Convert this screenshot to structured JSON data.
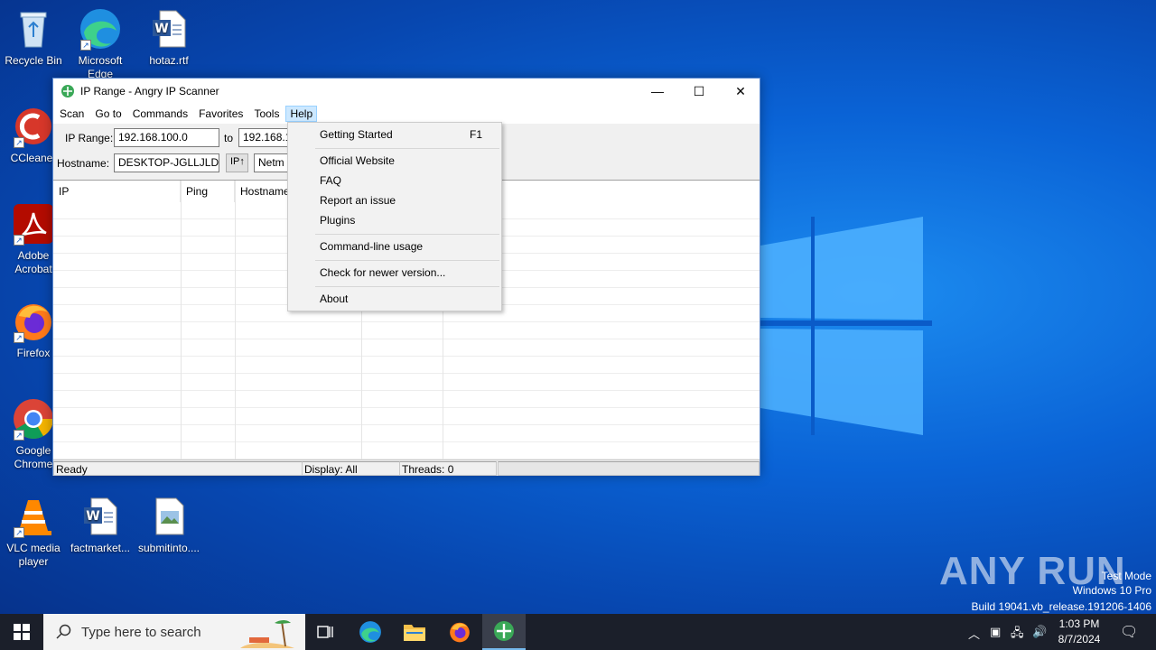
{
  "desktop": {
    "icons": [
      {
        "label": "Recycle Bin"
      },
      {
        "label": "Microsoft Edge"
      },
      {
        "label": "hotaz.rtf"
      },
      {
        "label": "CCleaner"
      },
      {
        "label": "Adobe Acrobat"
      },
      {
        "label": "Firefox"
      },
      {
        "label": "Google Chrome"
      },
      {
        "label": "VLC media player"
      },
      {
        "label": "factmarket..."
      },
      {
        "label": "submitinto...."
      }
    ]
  },
  "window": {
    "title": "IP Range - Angry IP Scanner",
    "controls": {
      "minimize": "—",
      "maximize": "☐",
      "close": "✕"
    },
    "menu": [
      "Scan",
      "Go to",
      "Commands",
      "Favorites",
      "Tools",
      "Help"
    ],
    "toolbar": {
      "ip_range_label": "IP Range:",
      "ip_from": "192.168.100.0",
      "to_label": "to",
      "ip_to": "192.168.1",
      "hostname_label": "Hostname:",
      "hostname": "DESKTOP-JGLLJLD",
      "ip_button": "IP↑",
      "netmask": "Netm"
    },
    "columns": [
      "IP",
      "Ping",
      "Hostname"
    ],
    "status": {
      "ready": "Ready",
      "display": "Display: All",
      "threads": "Threads: 0"
    }
  },
  "help_menu": {
    "items": [
      {
        "label": "Getting Started",
        "shortcut": "F1"
      },
      {
        "label": "Official Website"
      },
      {
        "label": "FAQ"
      },
      {
        "label": "Report an issue"
      },
      {
        "label": "Plugins"
      },
      {
        "label": "Command-line usage"
      },
      {
        "label": "Check for newer version..."
      },
      {
        "label": "About"
      }
    ]
  },
  "watermark": {
    "logo": "ANY RUN",
    "line1": "Test Mode",
    "line2": "Windows 10 Pro",
    "line3": "Build 19041.vb_release.191206-1406"
  },
  "taskbar": {
    "search_placeholder": "Type here to search",
    "time": "1:03 PM",
    "date": "8/7/2024"
  }
}
